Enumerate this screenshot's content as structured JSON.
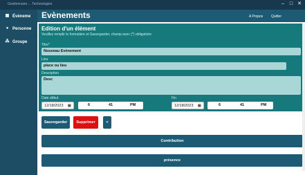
{
  "window": {
    "title": "Gestionnaire ... Technologies"
  },
  "sidebar": {
    "items": [
      {
        "label": "Évèneme",
        "icon": "calendar-icon"
      },
      {
        "label": "Personne",
        "icon": "person-icon"
      },
      {
        "label": "Groupe",
        "icon": "group-icon"
      }
    ]
  },
  "header": {
    "title": "Evènements",
    "about_label": "A Propos",
    "quit_label": "Quitter"
  },
  "form": {
    "title": "Edition d'un élément",
    "subtitle": "Veuillez remplir le formulaire et Sauvegarder, champ avec (*) obligatoire",
    "title_label": "Titre*",
    "title_value": "Nouveau Evènement",
    "place_label": "Lieu",
    "place_value": "place ou lieu",
    "description_label": "Description",
    "description_value": "Desc",
    "start_label": "Date début",
    "start_date": "12/18/2023",
    "start_hour": "6",
    "start_minute": "41",
    "start_ampm": "PM",
    "end_label": "Fin",
    "end_date": "12/18/2023",
    "end_hour": "6",
    "end_minute": "41",
    "end_ampm": "PM"
  },
  "actions": {
    "save_label": "Sauvegarder",
    "delete_label": "Supprimer",
    "back_label": "<"
  },
  "sections": {
    "contribution_label": "Contribution",
    "presence_label": "présence"
  },
  "colors": {
    "sidebar": "#1d4d65",
    "header": "#1d5a74",
    "form_panel": "#167a7d",
    "field": "#a9d7d7",
    "delete": "#e00f0f"
  }
}
